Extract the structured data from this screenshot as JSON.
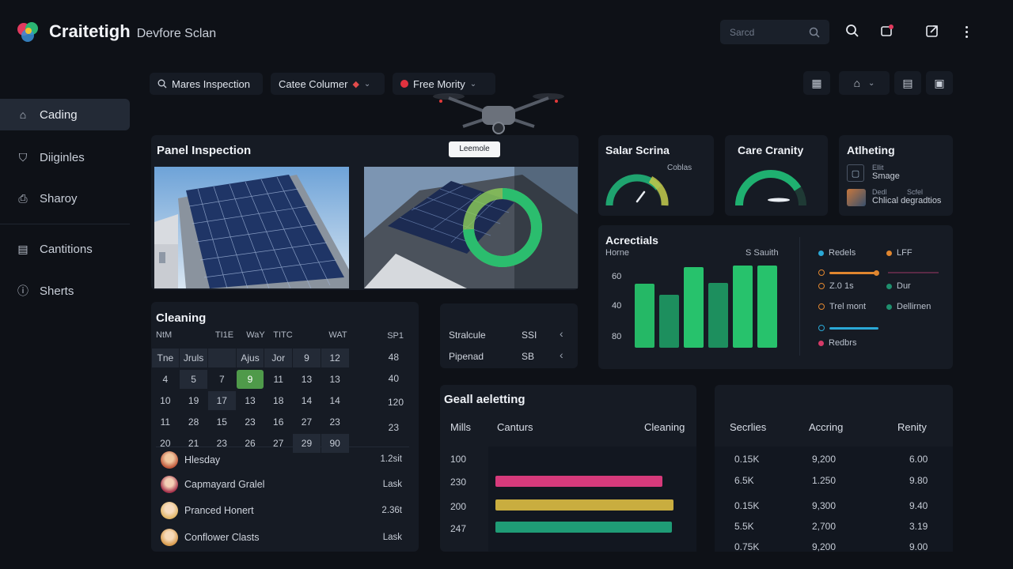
{
  "app": {
    "title": "Craitetigh",
    "subtitle": "Devfore Sclan"
  },
  "header": {
    "search_placeholder": "Sarcd"
  },
  "filters": [
    {
      "label": "Mares Inspection"
    },
    {
      "label": "Catee Columer"
    },
    {
      "label": "Free Mority"
    }
  ],
  "sidebar": {
    "items": [
      {
        "label": "Cading",
        "icon": "home-icon"
      },
      {
        "label": "Diiginles",
        "icon": "shield-icon"
      },
      {
        "label": "Sharoy",
        "icon": "document-icon"
      },
      {
        "label": "Cantitions",
        "icon": "clipboard-icon"
      },
      {
        "label": "Sherts",
        "icon": "info-icon"
      }
    ]
  },
  "panel_inspection": {
    "title": "Panel Inspection",
    "tooltip": "Leemole"
  },
  "solar_score": {
    "title": "Salar Scrina",
    "note": "Coblas",
    "value": 0.78
  },
  "care_gravity": {
    "title": "Care Cranity",
    "value": 0.82
  },
  "alerting": {
    "title": "Atlheting",
    "items": [
      {
        "top": "Ellit",
        "bottom": "Smage"
      },
      {
        "top_a": "Dedl",
        "top_b": "Scfel",
        "bottom": "Chlical degradtios"
      }
    ]
  },
  "acrectals": {
    "title": "Acrectials",
    "left_label": "Horne",
    "right_label": "S Sauith",
    "legend": [
      {
        "label": "Redels",
        "color": "#2aa8d6",
        "kind": "dot"
      },
      {
        "label": "LFF",
        "color": "#e0862f",
        "kind": "dot"
      },
      {
        "label": "Z.0 1s",
        "color": "#e0862f",
        "kind": "ring"
      },
      {
        "label": "Dur",
        "color": "#1f8f6e",
        "kind": "dot"
      },
      {
        "label": "Trel mont",
        "color": "#e0862f",
        "kind": "ring"
      },
      {
        "label": "Dellirnen",
        "color": "#1f8f6e",
        "kind": "dot"
      },
      {
        "label": "Redbrs",
        "color": "#d63a67",
        "kind": "dot"
      }
    ]
  },
  "chart_data": {
    "type": "bar",
    "title": "Acrectials",
    "yticks": [
      "60",
      "40",
      "80"
    ],
    "values": [
      0.78,
      0.64,
      0.98,
      0.79,
      1.0,
      1.0
    ],
    "colors": [
      "#25b866",
      "#1d8f5e",
      "#27c26c",
      "#1d8f5e",
      "#27c26c",
      "#27c26c"
    ]
  },
  "cleaning": {
    "title": "Cleaning",
    "headers": [
      "NtM",
      "TI1E",
      "WaY",
      "TITC",
      "WAT"
    ],
    "header_right": "SP1",
    "rows": [
      {
        "cells": [
          "Tne",
          "Jruls",
          "",
          "Ajus",
          "Jor",
          "9",
          "12"
        ],
        "right": "48"
      },
      {
        "cells": [
          "4",
          "5",
          "7",
          "9",
          "11",
          "13",
          "13"
        ],
        "right": "40"
      },
      {
        "cells": [
          "10",
          "19",
          "17",
          "13",
          "18",
          "14",
          "14"
        ],
        "right": "120"
      },
      {
        "cells": [
          "11",
          "28",
          "15",
          "23",
          "16",
          "27",
          "23"
        ],
        "right": "23"
      },
      {
        "cells": [
          "20",
          "21",
          "23",
          "26",
          "27",
          "29",
          "90"
        ],
        "right": ""
      }
    ],
    "people": [
      {
        "name": "Hlesday",
        "value": "1.2sit",
        "color": "#c0583b"
      },
      {
        "name": "Capmayard Gralel",
        "value": "Lask",
        "color": "#a6324b"
      },
      {
        "name": "Pranced Honert",
        "value": "2.36t",
        "color": "#e2b667"
      },
      {
        "name": "Conflower Clasts",
        "value": "Lask",
        "color": "#d89b4d"
      }
    ]
  },
  "schedule": {
    "rows": [
      {
        "label": "Stralcule",
        "value": "SSI"
      },
      {
        "label": "Pipenad",
        "value": "SB"
      }
    ]
  },
  "goal_alerting": {
    "title": "Geall aeletting",
    "headers": [
      "Mills",
      "Canturs",
      "Cleaning"
    ],
    "rows": [
      {
        "mills": "100",
        "bar": 0,
        "color": ""
      },
      {
        "mills": "230",
        "bar": 0.87,
        "color": "#d63a7b"
      },
      {
        "mills": "200",
        "bar": 0.93,
        "color": "#c9ad3f"
      },
      {
        "mills": "247",
        "bar": 0.92,
        "color": "#1f9c76"
      }
    ]
  },
  "series_table": {
    "headers": [
      "Secrlies",
      "Accring",
      "Renity"
    ],
    "rows": [
      [
        "0.15K",
        "9,200",
        "6.00"
      ],
      [
        "6.5K",
        "1.250",
        "9.80"
      ],
      [
        "0.15K",
        "9,300",
        "9.40"
      ],
      [
        "5.5K",
        "2,700",
        "3.19"
      ],
      [
        "0.75K",
        "9,200",
        "9.00"
      ]
    ]
  }
}
